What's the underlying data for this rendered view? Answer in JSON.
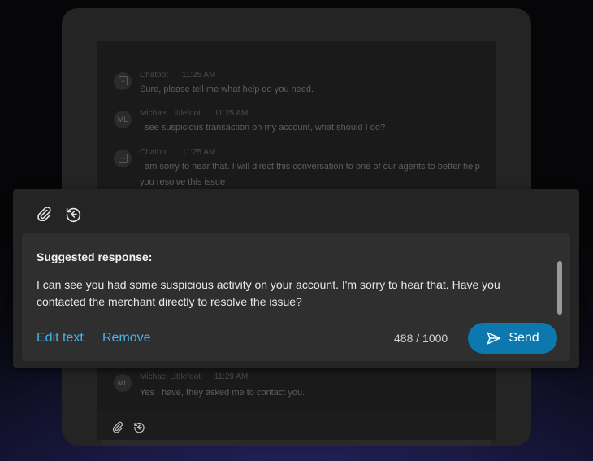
{
  "chat": {
    "messages": [
      {
        "avatar": "",
        "icon": "bot-icon",
        "sender": "Chatbot",
        "time": "11:25 AM",
        "text": "Sure, please tell me what help do you need."
      },
      {
        "avatar": "ML",
        "sender": "Michael Littlefoot",
        "time": "11:25 AM",
        "text": "I see suspicious transaction on my account, what should I do?"
      },
      {
        "avatar": "",
        "icon": "bot-icon",
        "sender": "Chatbot",
        "time": "11:25 AM",
        "text": "I am sorry to hear that. I will direct this conversation to one of our agents to better help you resolve this issue"
      },
      {
        "avatar": "ML",
        "sender": "Michael Littlefoot",
        "time": "11:29 AM",
        "text": "Yes I have, they asked me to contact you."
      }
    ]
  },
  "toolbar": {
    "icons": [
      "paperclip-icon",
      "history-icon"
    ]
  },
  "suggestion": {
    "title": "Suggested response:",
    "body": "I can see you had some suspicious activity on your account. I'm sorry to hear that. Have you contacted the merchant directly to resolve the issue?",
    "edit_label": "Edit text",
    "remove_label": "Remove",
    "char_count": "488 / 1000",
    "send_label": "Send"
  },
  "colors": {
    "accent": "#0d78ad",
    "link": "#49b2e8"
  }
}
